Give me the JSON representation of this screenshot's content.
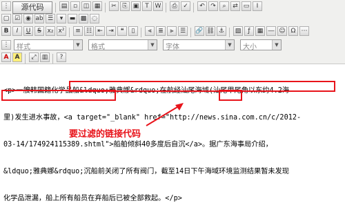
{
  "toolbar": {
    "source_button": "源代码",
    "style_label": "样式",
    "format_label": "格式",
    "font_label": "字体",
    "size_label": "大小"
  },
  "editor": {
    "lines": [
      "<p>一艘韩国籍化学品船&ldquo;雅典娜&rdquo;在航经汕尾海域(汕尾甲尾角以东约4.2海",
      "里)发生进水事故，<a target=\"_blank\" href=\"http://news.sina.com.cn/c/2012-",
      "03-14/174924115389.shtml\">船舶倾斜40多度后自沉</a>。据广东海事局介绍，",
      "&ldquo;雅典娜&rdquo;沉船前关闭了所有阀门，截至14日下午海域环境监测结果暂未发现",
      "化学品泄漏，船上所有船员在弃船后已被全部救起。</p>"
    ]
  },
  "annotation": {
    "caption": "要过滤的链接代码",
    "color": "#e8131a"
  }
}
